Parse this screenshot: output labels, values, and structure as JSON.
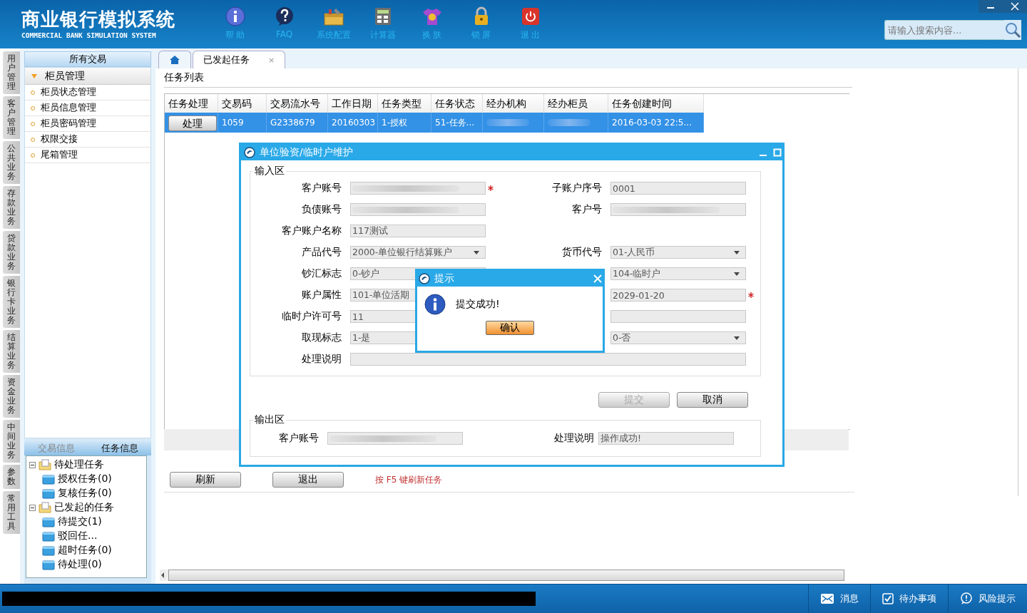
{
  "header": {
    "title": "商业银行模拟系统",
    "subtitle": "COMMERCIAL BANK SIMULATION SYSTEM",
    "tools": [
      {
        "kind": "info",
        "label": "帮 助"
      },
      {
        "kind": "faq",
        "label": "FAQ"
      },
      {
        "kind": "config",
        "label": "系统配置"
      },
      {
        "kind": "calc",
        "label": "计算器"
      },
      {
        "kind": "skin",
        "label": "换 肤"
      },
      {
        "kind": "lock",
        "label": "锁 屏"
      },
      {
        "kind": "exit",
        "label": "退 出"
      }
    ],
    "search": {
      "placeholder": "请输入搜索内容..."
    }
  },
  "side_tabs": [
    "用户管理",
    "客户管理",
    "公共业务",
    "存款业务",
    "贷款业务",
    "银行卡业务",
    "结算业务",
    "资金业务",
    "中间业务",
    "参数",
    "常用工具"
  ],
  "nav": {
    "header": "所有交易",
    "group": {
      "label": "柜员管理",
      "expanded": true,
      "items": [
        "柜员状态管理",
        "柜员信息管理",
        "柜员密码管理",
        "权限交接",
        "尾箱管理"
      ]
    }
  },
  "info_tabs": [
    {
      "label": "交易信息",
      "selected": false
    },
    {
      "label": "任务信息",
      "selected": true
    }
  ],
  "tree": [
    {
      "label": "待处理任务",
      "expanded": true,
      "children": [
        {
          "label": "授权任务(0)"
        },
        {
          "label": "复核任务(0)"
        }
      ]
    },
    {
      "label": "已发起的任务",
      "expanded": true,
      "children": [
        {
          "label": "待提交(1)"
        },
        {
          "label": "驳回任..."
        },
        {
          "label": "超时任务(0)"
        },
        {
          "label": "待处理(0)"
        }
      ]
    }
  ],
  "tabs": [
    {
      "kind": "home",
      "selected": false
    },
    {
      "kind": "page",
      "label": "已发起任务",
      "close": "×",
      "selected": true
    }
  ],
  "task_list": {
    "title": "任务列表",
    "columns": [
      "任务处理",
      "交易码",
      "交易流水号",
      "工作日期",
      "任务类型",
      "任务状态",
      "经办机构",
      "经办柜员",
      "任务创建时间"
    ],
    "rows": [
      {
        "selected": true,
        "cells": [
          {
            "kind": "button",
            "text": "处理"
          },
          {
            "kind": "text",
            "text": "1059"
          },
          {
            "kind": "text",
            "text": "G2338679"
          },
          {
            "kind": "text",
            "text": "20160303"
          },
          {
            "kind": "text",
            "text": "1-授权"
          },
          {
            "kind": "text",
            "text": "51-任务..."
          },
          {
            "kind": "blurred"
          },
          {
            "kind": "blurred"
          },
          {
            "kind": "text",
            "text": "2016-03-03 22:5..."
          }
        ]
      }
    ]
  },
  "buttons": [
    "刷新",
    "退出"
  ],
  "hint": "按 F5 键刷新任务",
  "dialog": {
    "title": "单位验资/临时户维护",
    "input_section": "输入区",
    "rows": [
      {
        "left": {
          "label": "客户账号",
          "kind": "blurred",
          "required": true
        },
        "right": {
          "label": "子账户序号",
          "kind": "text",
          "value": "0001",
          "required": false
        }
      },
      {
        "left": {
          "label": "负债账号",
          "kind": "blurred",
          "required": false
        },
        "right": {
          "label": "客户号",
          "kind": "blurred",
          "required": false
        }
      },
      {
        "left": {
          "label": "客户账户名称",
          "kind": "text",
          "value": "117测试",
          "required": false
        }
      },
      {
        "left": {
          "label": "产品代号",
          "kind": "select",
          "value": "2000-单位银行结算账户",
          "required": false
        },
        "right": {
          "label": "货币代号",
          "kind": "select",
          "value": "01-人民币",
          "required": false
        }
      },
      {
        "left": {
          "label": "钞汇标志",
          "kind": "text",
          "value": "0-钞户",
          "required": false
        },
        "right": {
          "kind": "select",
          "value": "104-临时户",
          "required": false
        }
      },
      {
        "left": {
          "label": "账户属性",
          "kind": "text",
          "value": "101-单位活期",
          "required": false
        },
        "right": {
          "kind": "text",
          "value": "2029-01-20",
          "required": true
        }
      },
      {
        "left": {
          "label": "临时户许可号",
          "kind": "text",
          "value": "11",
          "required": false
        },
        "right": {
          "kind": "text",
          "required": false
        }
      },
      {
        "left": {
          "label": "取现标志",
          "kind": "text",
          "value": "1-是",
          "required": false
        },
        "right": {
          "kind": "select",
          "value": "0-否",
          "required": false
        }
      },
      {
        "wide": {
          "label": "处理说明",
          "kind": "text",
          "required": false
        }
      }
    ],
    "buttons": [
      {
        "label": "提交",
        "disabled": true
      },
      {
        "label": "取消",
        "disabled": false
      }
    ],
    "output_section": "输出区",
    "output": [
      {
        "label": "客户账号",
        "kind": "blurred"
      },
      {
        "label": "处理说明",
        "kind": "text",
        "value": "操作成功!"
      }
    ]
  },
  "alert": {
    "title": "提示",
    "message": "提交成功!",
    "button": "确认"
  },
  "status_bar": [
    {
      "kind": "message",
      "label": "消息"
    },
    {
      "kind": "todo",
      "label": "待办事项"
    },
    {
      "kind": "risk",
      "label": "风险提示"
    }
  ]
}
